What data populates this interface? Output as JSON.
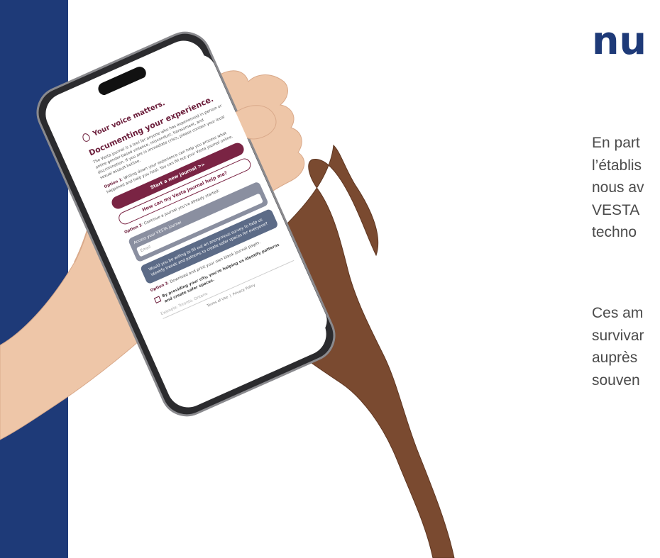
{
  "heading": "nu",
  "paragraphs": [
    {
      "lines": [
        "En part",
        "l’établis",
        "nous av",
        "VESTA",
        "techno"
      ]
    },
    {
      "lines": [
        "Ces am",
        "survivar",
        "auprès",
        "souven"
      ]
    }
  ],
  "phone": {
    "header": "Your voice matters.",
    "title": "Documenting your experience.",
    "intro": "The Vesta journal is a tool for anyone who has experienced in-person or online gender-based violence, misconduct, harassment, and discrimination. If you are in immediate crisis, please contact your local sexual assault hotline.",
    "option1_label": "Option 1",
    "option1_text": ": Writing down your experience can help you process what happened and help you heal. You can fill out your Vesta journal online.",
    "start_button": "Start a new journal >>",
    "help_button": "How can my Vesta journal help me?",
    "option2_label": "Option 2",
    "option2_text": ": Continue a journal you've already started:",
    "access_label": "Access your VESTA journal",
    "access_placeholder": "Email",
    "survey_text": "Would you be willing to fill out an anonymous survey to help us identify trends and patterns to create safer spaces for everyone?",
    "option3_label": "Option 3",
    "option3_text": ": Download and print your own blank journal pages.",
    "consent_text": "By providing your city, you're helping us identify patterns and create safer spaces.",
    "zip_placeholder": "Example: Toronto, Ontario",
    "terms_link": "Terms of Use",
    "privacy_link": "Privacy Policy"
  },
  "colors": {
    "sidebar": "#1e3a78",
    "heading": "#1e3a78",
    "body_text": "#4b4b4b",
    "brand": "#7a2444"
  }
}
